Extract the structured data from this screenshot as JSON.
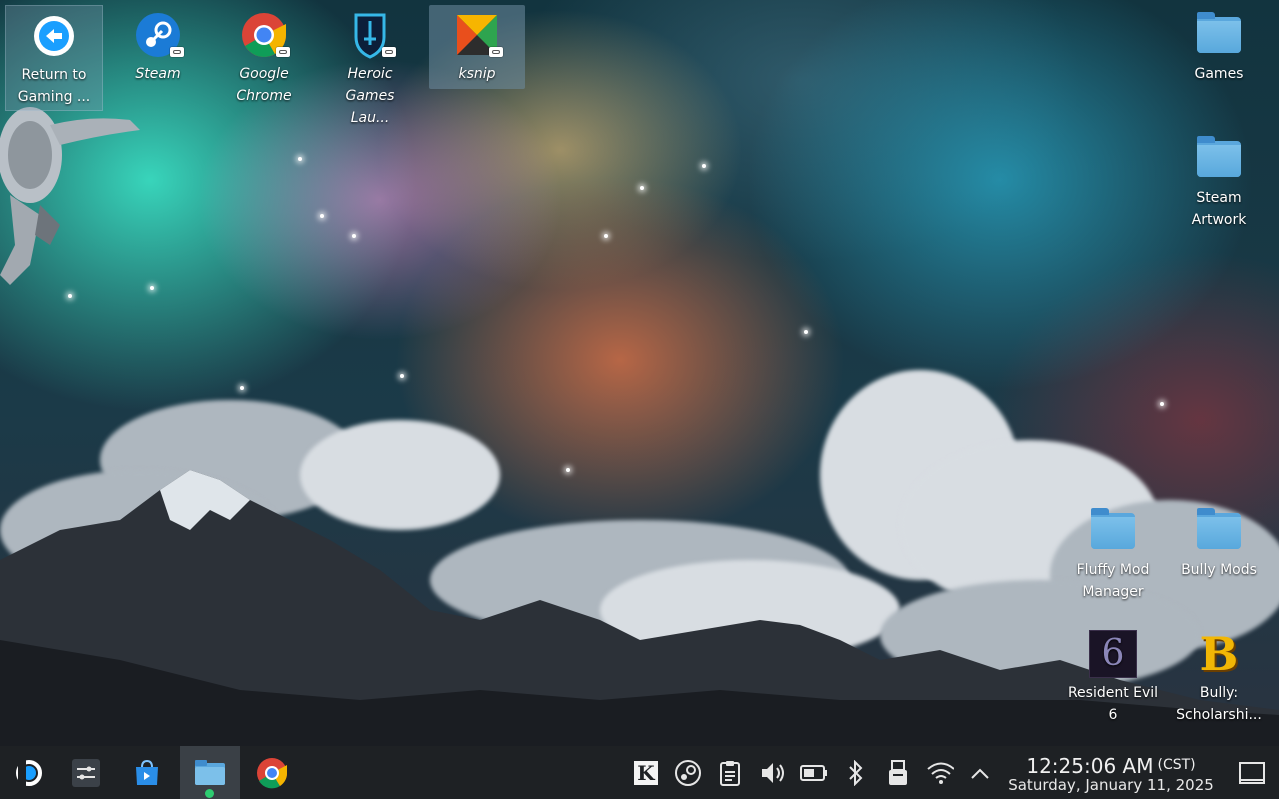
{
  "desktop": {
    "icons": [
      {
        "id": "return-to-gaming",
        "label": "Return to Gaming ..."
      },
      {
        "id": "steam",
        "label": "Steam"
      },
      {
        "id": "google-chrome",
        "label": "Google Chrome"
      },
      {
        "id": "heroic",
        "label": "Heroic Games Lau..."
      },
      {
        "id": "ksnip",
        "label": "ksnip"
      },
      {
        "id": "games",
        "label": "Games"
      },
      {
        "id": "steam-artwork",
        "label": "Steam Artwork"
      },
      {
        "id": "fluffy-mod-manager",
        "label": "Fluffy Mod Manager"
      },
      {
        "id": "bully-mods",
        "label": "Bully Mods"
      },
      {
        "id": "resident-evil-6",
        "label": "Resident Evil 6"
      },
      {
        "id": "bully-scholarship",
        "label": "Bully: Scholarshi..."
      }
    ],
    "re6_glyph": "6",
    "bully_glyph": "B"
  },
  "taskbar": {
    "launcher_icon": "steamdeck-logo-icon",
    "pinned": [
      "mixer-icon",
      "discover-store-icon",
      "file-manager-icon",
      "chrome-icon"
    ],
    "tray": [
      "ksnip-tray-icon",
      "steam-tray-icon",
      "clipboard-icon",
      "volume-icon",
      "battery-icon",
      "bluetooth-icon",
      "usb-device-icon",
      "wifi-icon",
      "chevron-up-icon"
    ],
    "ksnip_glyph": "K",
    "clock": {
      "time": "12:25:06 AM",
      "timezone": "(CST)",
      "date": "Saturday, January 11, 2025"
    },
    "show_desktop_icon": "show-desktop-icon"
  },
  "colors": {
    "taskbar": "#1e2124",
    "folder": "#5aa7dd",
    "accent": "#1a9fff"
  }
}
